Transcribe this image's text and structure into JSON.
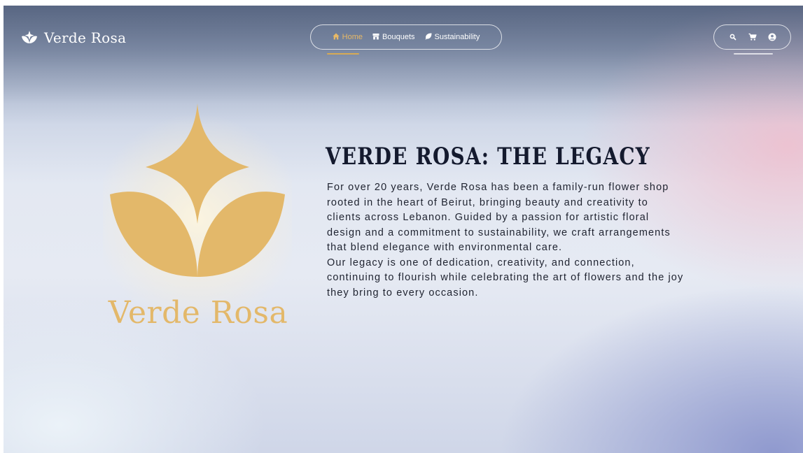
{
  "brand": {
    "name": "Verde Rosa",
    "icon": "lotus-icon"
  },
  "nav": {
    "items": [
      {
        "label": "Home",
        "icon": "home-icon",
        "active": true
      },
      {
        "label": "Bouquets",
        "icon": "store-icon",
        "active": false
      },
      {
        "label": "Sustainability",
        "icon": "leaf-icon",
        "active": false
      }
    ]
  },
  "actions": {
    "icons": [
      "search-icon",
      "cart-icon",
      "user-icon"
    ]
  },
  "hero": {
    "logo_word": "Verde Rosa",
    "title": "VERDE ROSA: THE LEGACY",
    "paragraph1": "For over 20 years, Verde Rosa has been a family-run flower shop rooted in the heart of Beirut, bringing beauty and creativity to clients across Lebanon. Guided by a passion for artistic floral design and a commitment to sustainability, we craft arrangements that blend elegance with environmental care.",
    "paragraph2": "Our legacy is one of dedication, creativity, and connection, continuing to flourish while celebrating the art of flowers and the joy they bring to every occasion."
  },
  "colors": {
    "accent": "#e3b86a",
    "active_nav": "#e7b866",
    "heading": "#141a2e"
  }
}
